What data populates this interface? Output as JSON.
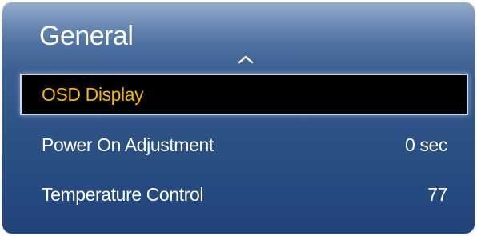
{
  "menu": {
    "title": "General",
    "items": [
      {
        "label": "OSD Display",
        "value": "",
        "selected": true
      },
      {
        "label": "Power On Adjustment",
        "value": "0 sec"
      },
      {
        "label": "Temperature Control",
        "value": "77"
      }
    ]
  },
  "colors": {
    "panel_top": "#6b8cb8",
    "panel_bottom": "#20447a",
    "highlight_text": "#f4b400",
    "highlight_bg": "#000000",
    "text": "#ffffff"
  },
  "icons": {
    "scroll_up": "chevron-up-icon"
  }
}
